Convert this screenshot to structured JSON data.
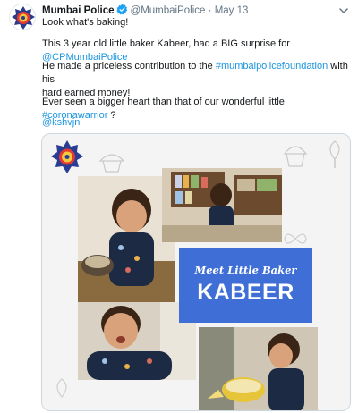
{
  "tweet": {
    "author_name": "Mumbai Police",
    "handle": "@MumbaiPolice",
    "separator": "·",
    "date": "May 13",
    "line1": "Look what's baking!",
    "line2_text": "This 3 year old little baker Kabeer, had a BIG surprise for ",
    "line2_mention": "@CPMumbaiPolice",
    "line3_text_a": "He made a priceless contribution to the ",
    "line3_hashtag": "#mumbaipolicefoundation",
    "line3_text_b": " with his",
    "line3_text_c": "hard earned money!",
    "line4_text_a": "Ever seen a bigger heart than that of our wonderful little ",
    "line4_hashtag": "#coronawarrior",
    "line4_text_b": " ?",
    "credit_mention": "@kshvjn"
  },
  "media": {
    "banner_line1": "Meet Little Baker",
    "banner_line2": "KABEER"
  },
  "colors": {
    "link": "#1b95e0",
    "verified": "#1da1f2",
    "banner": "#3f6fd6",
    "meta": "#657786"
  },
  "icons": {
    "avatar": "mumbai-police-emblem",
    "verified": "verified-badge",
    "menu": "chevron-down"
  }
}
